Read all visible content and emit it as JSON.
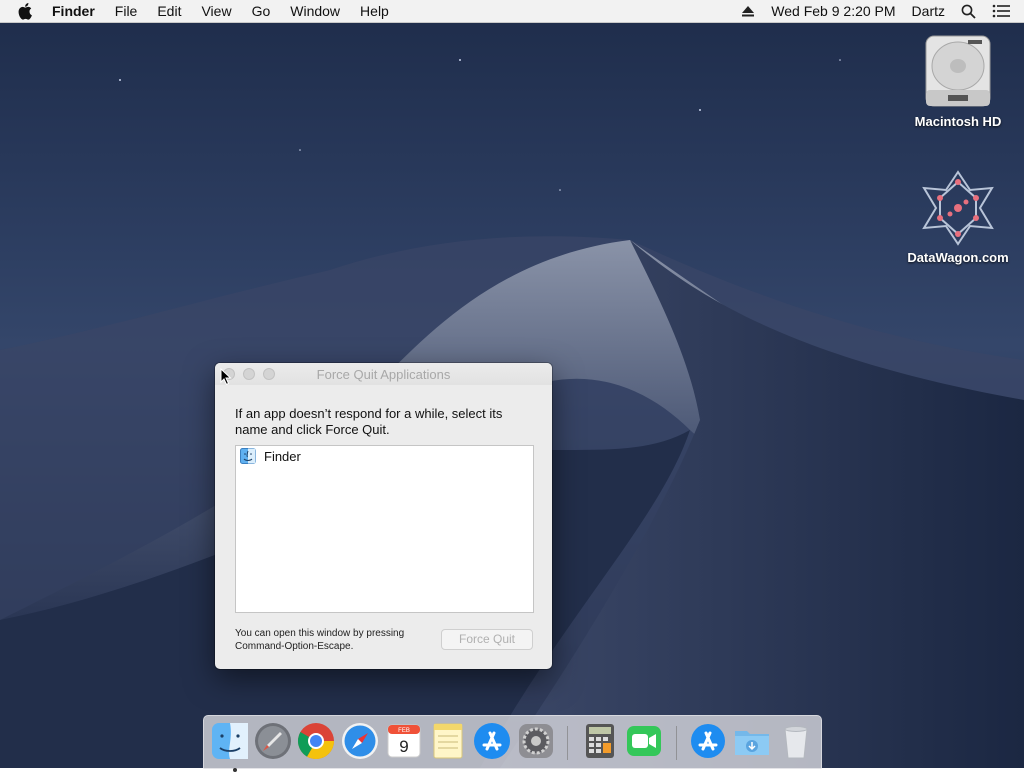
{
  "menubar": {
    "app": "Finder",
    "menus": [
      "File",
      "Edit",
      "View",
      "Go",
      "Window",
      "Help"
    ],
    "clock": "Wed Feb 9  2:20 PM",
    "user": "Dartz"
  },
  "desktop_icons": [
    {
      "label": "Macintosh HD",
      "icon": "hard-drive-icon"
    },
    {
      "label": "DataWagon.com",
      "icon": "datawagon-icon"
    }
  ],
  "window": {
    "title": "Force Quit Applications",
    "description": "If an app doesn’t respond for a while, select its name and click Force Quit.",
    "apps": [
      {
        "name": "Finder",
        "icon": "finder-icon"
      }
    ],
    "hint": "You can open this window by pressing Command-Option-Escape.",
    "force_quit_label": "Force Quit"
  },
  "dock": {
    "items": [
      "finder",
      "launchpad",
      "chrome",
      "safari",
      "calendar",
      "notes",
      "app-store",
      "system-preferences",
      "calculator",
      "facetime",
      "app-store-downloads",
      "downloads-folder",
      "trash"
    ],
    "calendar": {
      "month": "FEB",
      "day": "9"
    }
  }
}
